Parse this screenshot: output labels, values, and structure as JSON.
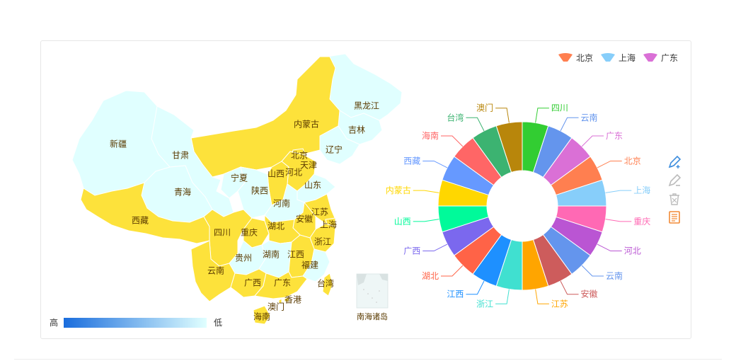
{
  "legend": [
    {
      "name": "北京",
      "color": "#ff7f50"
    },
    {
      "name": "上海",
      "color": "#87cefa"
    },
    {
      "name": "广东",
      "color": "#da70d6"
    }
  ],
  "visual_map": {
    "high_label": "高",
    "low_label": "低",
    "high_color": "#1a6ddd",
    "low_color": "#e0ffff"
  },
  "map": {
    "fill_active": "#fde23b",
    "fill_inactive": "#e0ffff",
    "islands_label": "南海诸岛",
    "provinces": [
      {
        "name": "黑龙江",
        "active": false
      },
      {
        "name": "吉林",
        "active": false
      },
      {
        "name": "辽宁",
        "active": false
      },
      {
        "name": "内蒙古",
        "active": true
      },
      {
        "name": "新疆",
        "active": false
      },
      {
        "name": "甘肃",
        "active": false
      },
      {
        "name": "青海",
        "active": false
      },
      {
        "name": "西藏",
        "active": true
      },
      {
        "name": "北京",
        "active": true
      },
      {
        "name": "天津",
        "active": true
      },
      {
        "name": "河北",
        "active": true
      },
      {
        "name": "山西",
        "active": true
      },
      {
        "name": "宁夏",
        "active": false
      },
      {
        "name": "陕西",
        "active": false
      },
      {
        "name": "山东",
        "active": false
      },
      {
        "name": "河南",
        "active": false
      },
      {
        "name": "江苏",
        "active": true
      },
      {
        "name": "安徽",
        "active": true
      },
      {
        "name": "上海",
        "active": true
      },
      {
        "name": "四川",
        "active": true
      },
      {
        "name": "重庆",
        "active": true
      },
      {
        "name": "湖北",
        "active": true
      },
      {
        "name": "浙江",
        "active": true
      },
      {
        "name": "贵州",
        "active": false
      },
      {
        "name": "湖南",
        "active": false
      },
      {
        "name": "江西",
        "active": true
      },
      {
        "name": "福建",
        "active": false
      },
      {
        "name": "云南",
        "active": true
      },
      {
        "name": "广西",
        "active": true
      },
      {
        "name": "广东",
        "active": true
      },
      {
        "name": "台湾",
        "active": true
      },
      {
        "name": "香港",
        "active": true
      },
      {
        "name": "澳门",
        "active": true
      },
      {
        "name": "海南",
        "active": true
      }
    ]
  },
  "chart_data": {
    "type": "pie",
    "variant": "donut",
    "slices": [
      {
        "name": "四川",
        "value": 1,
        "color": "#32cd32"
      },
      {
        "name": "云南",
        "value": 1,
        "color": "#6495ed"
      },
      {
        "name": "广东",
        "value": 1,
        "color": "#da70d6"
      },
      {
        "name": "北京",
        "value": 1,
        "color": "#ff7f50"
      },
      {
        "name": "上海",
        "value": 1,
        "color": "#87cefa"
      },
      {
        "name": "重庆",
        "value": 1,
        "color": "#ff69b4"
      },
      {
        "name": "河北",
        "value": 1,
        "color": "#ba55d3"
      },
      {
        "name": "云南",
        "value": 1,
        "color": "#6495ed"
      },
      {
        "name": "安徽",
        "value": 1,
        "color": "#cd5c5c"
      },
      {
        "name": "江苏",
        "value": 1,
        "color": "#ffa500"
      },
      {
        "name": "浙江",
        "value": 1,
        "color": "#40e0d0"
      },
      {
        "name": "江西",
        "value": 1,
        "color": "#1e90ff"
      },
      {
        "name": "湖北",
        "value": 1,
        "color": "#ff6347"
      },
      {
        "name": "广西",
        "value": 1,
        "color": "#7b68ee"
      },
      {
        "name": "山西",
        "value": 1,
        "color": "#00fa9a"
      },
      {
        "name": "内蒙古",
        "value": 1,
        "color": "#ffd700"
      },
      {
        "name": "西藏",
        "value": 1,
        "color": "#6699ff"
      },
      {
        "name": "海南",
        "value": 1,
        "color": "#ff6666"
      },
      {
        "name": "台湾",
        "value": 1,
        "color": "#3cb371"
      },
      {
        "name": "澳门",
        "value": 1,
        "color": "#b8860b"
      }
    ]
  },
  "toolbox": [
    {
      "icon": "mark-pen-icon",
      "color": "#3c8dde"
    },
    {
      "icon": "undo-mark-icon",
      "color": "#bbbbbb"
    },
    {
      "icon": "clear-mark-icon",
      "color": "#bbbbbb"
    },
    {
      "icon": "data-view-icon",
      "color": "#f28a36"
    }
  ]
}
